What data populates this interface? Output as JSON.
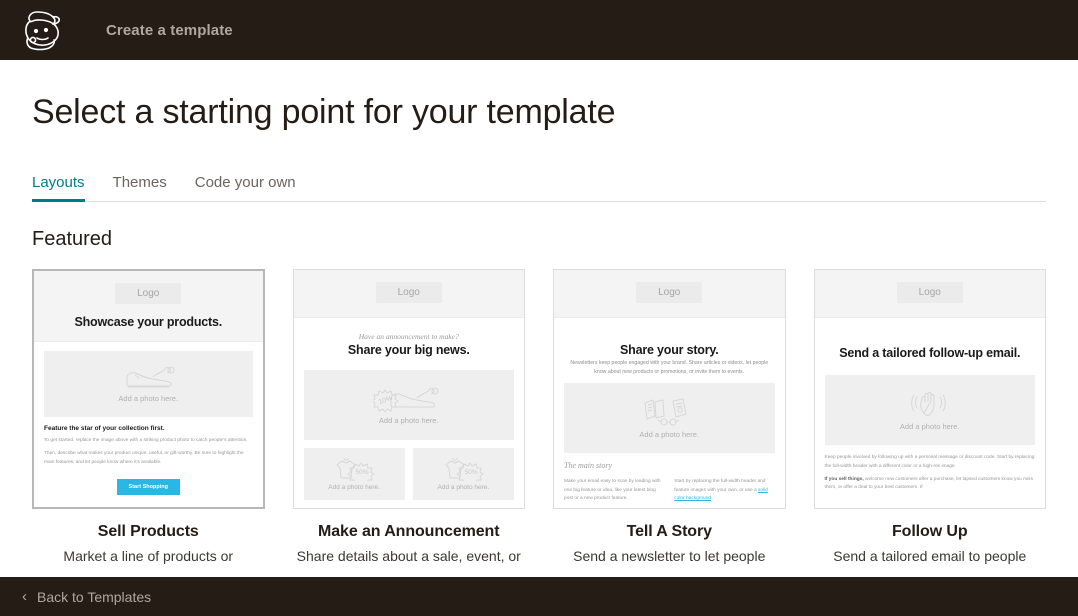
{
  "topbar": {
    "logo_icon": "mailchimp-freddie-logo",
    "title": "Create a template"
  },
  "page": {
    "title": "Select a starting point for your template",
    "section_title": "Featured"
  },
  "tabs": [
    {
      "label": "Layouts",
      "active": true
    },
    {
      "label": "Themes",
      "active": false
    },
    {
      "label": "Code your own",
      "active": false
    }
  ],
  "cards": [
    {
      "name": "Sell Products",
      "description": "Market a line of products or",
      "selected": true,
      "preview": {
        "logo_label": "Logo",
        "headline": "Showcase your products.",
        "photo_label": "Add a photo here.",
        "photo_icon": "shoe-icon",
        "subhead": "Feature the star of your collection first.",
        "paragraph1": "To get started, replace the image above with a striking product photo to catch people's attention.",
        "paragraph2": "Then, describe what makes your product unique, useful, or gift-worthy. Be sure to highlight the main features, and let people know where it's available.",
        "cta_label": "Start Shopping"
      }
    },
    {
      "name": "Make an Announcement",
      "description": "Share details about a sale, event, or",
      "selected": false,
      "preview": {
        "logo_label": "Logo",
        "kicker": "Have an announcement to make?",
        "headline": "Share your big news.",
        "photo_label": "Add a photo here.",
        "photo_icon": "shoe-discount-icon",
        "photo_label_left": "Add a photo here.",
        "photo_label_right": "Add a photo here.",
        "photo_icon_left": "tshirt-50-percent-icon",
        "photo_icon_right": "tshirt-50-percent-icon"
      }
    },
    {
      "name": "Tell A Story",
      "description": "Send a newsletter to let people",
      "selected": false,
      "preview": {
        "logo_label": "Logo",
        "headline": "Share your story.",
        "lede": "Newsletters keep people engaged with your brand. Share articles or videos, let people know about new products or promotions, or invite them to events.",
        "photo_label": "Add a photo here.",
        "photo_icon": "books-icon",
        "serif_subhead": "The main story",
        "column_left": "Make your email easy to scan by leading with one big feature or idea, like your latest blog post or a new product feature.",
        "column_right_pre": "Start by replacing the full-width header and feature images with your own, or use a ",
        "column_right_link": "solid color background",
        "column_right_post": "."
      }
    },
    {
      "name": "Follow Up",
      "description": "Send a tailored email to people",
      "selected": false,
      "preview": {
        "logo_label": "Logo",
        "headline": "Send a tailored follow-up email.",
        "photo_label": "Add a photo here.",
        "photo_icon": "waving-hand-icon",
        "paragraph1": "Keep people involved by following up with a personal message or discount code. Start by replacing the full-width header with a different color or a high-res image.",
        "paragraph2_bold": "If you sell things,",
        "paragraph2": " welcome new customers after a purchase, let lapsed customers know you miss them, or offer a deal to your best customers. If"
      }
    }
  ],
  "footer": {
    "back_label": "Back to Templates",
    "chevron": "‹"
  },
  "colors": {
    "dark_bar": "#241c15",
    "accent_teal": "#007c89",
    "cta_blue": "#2ab7e6",
    "link_blue": "#2ab7e6"
  }
}
